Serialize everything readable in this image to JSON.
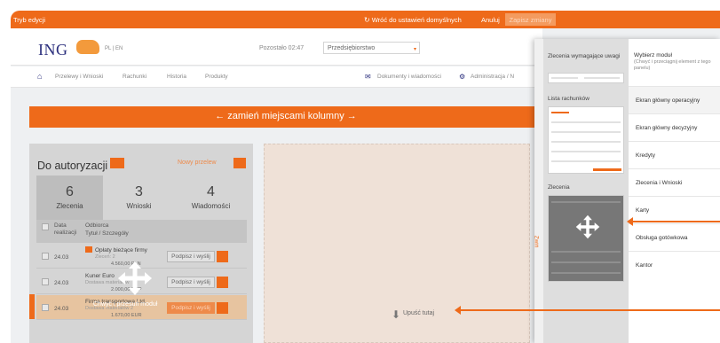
{
  "editbar": {
    "mode": "Tryb edycji",
    "reset": "Wróć do ustawień domyślnych",
    "cancel": "Anuluj",
    "save": "Zapisz zmiany"
  },
  "header": {
    "logo": "ING",
    "lang": "PL | EN",
    "remaining": "Pozostało 02:47",
    "company": "Przedsiębiorstwo"
  },
  "nav": {
    "items": [
      "Przelewy i Wnioski",
      "Rachunki",
      "Historia",
      "Produkty"
    ],
    "documents": "Dokumenty i wiadomości",
    "admin": "Administracja / N"
  },
  "swap": "← zamień miejscami kolumny →",
  "module": {
    "title": "Do autoryzacji",
    "new_payment": "Nowy przelew",
    "tabs": [
      {
        "num": "6",
        "label": "Zlecenia"
      },
      {
        "num": "3",
        "label": "Wnioski"
      },
      {
        "num": "4",
        "label": "Wiadomości"
      }
    ],
    "col_date": "Data realizacji",
    "col_recipient": "Odbiorca",
    "col_title": "Tytuł / Szczegóły",
    "rows": [
      {
        "date": "24.03",
        "name": "Opłaty bieżące firmy",
        "sub": "Zleceń: 2",
        "amount": "4.560,00 PLN",
        "btn": "Podpisz i wyślij"
      },
      {
        "date": "24.03",
        "name": "Kuner Euro",
        "sub": "Dostawa materiałów",
        "amount": "2.000,00 GBP",
        "btn": "Podpisz i wyślij"
      },
      {
        "date": "24.03",
        "name": "Firma transportowa Ltd.",
        "sub": "Dostawa materiałów 2",
        "amount": "1.670,00 EUR",
        "btn": "Podpisz i wyślij"
      }
    ],
    "move_label": "Chwyć i przesuń moduł"
  },
  "dropzone": {
    "label": "Upuść tutaj"
  },
  "panel": {
    "collapse": "Zwiń",
    "preview_1_title": "Zlecenia wymagające uwagi",
    "preview_2_title": "Lista rachunków",
    "preview_3_title": "Zlecenia",
    "menu_head": "Wybierz moduł",
    "menu_hint": "(Chwyć i przeciągnij element z tego panelu)",
    "menu_items": [
      "Ekran główny operacyjny",
      "Ekran główny decyzyjny",
      "Kredyty",
      "Zlecenia i Wnioski",
      "Karty",
      "Obsługa gotówkowa",
      "Kantor"
    ]
  }
}
